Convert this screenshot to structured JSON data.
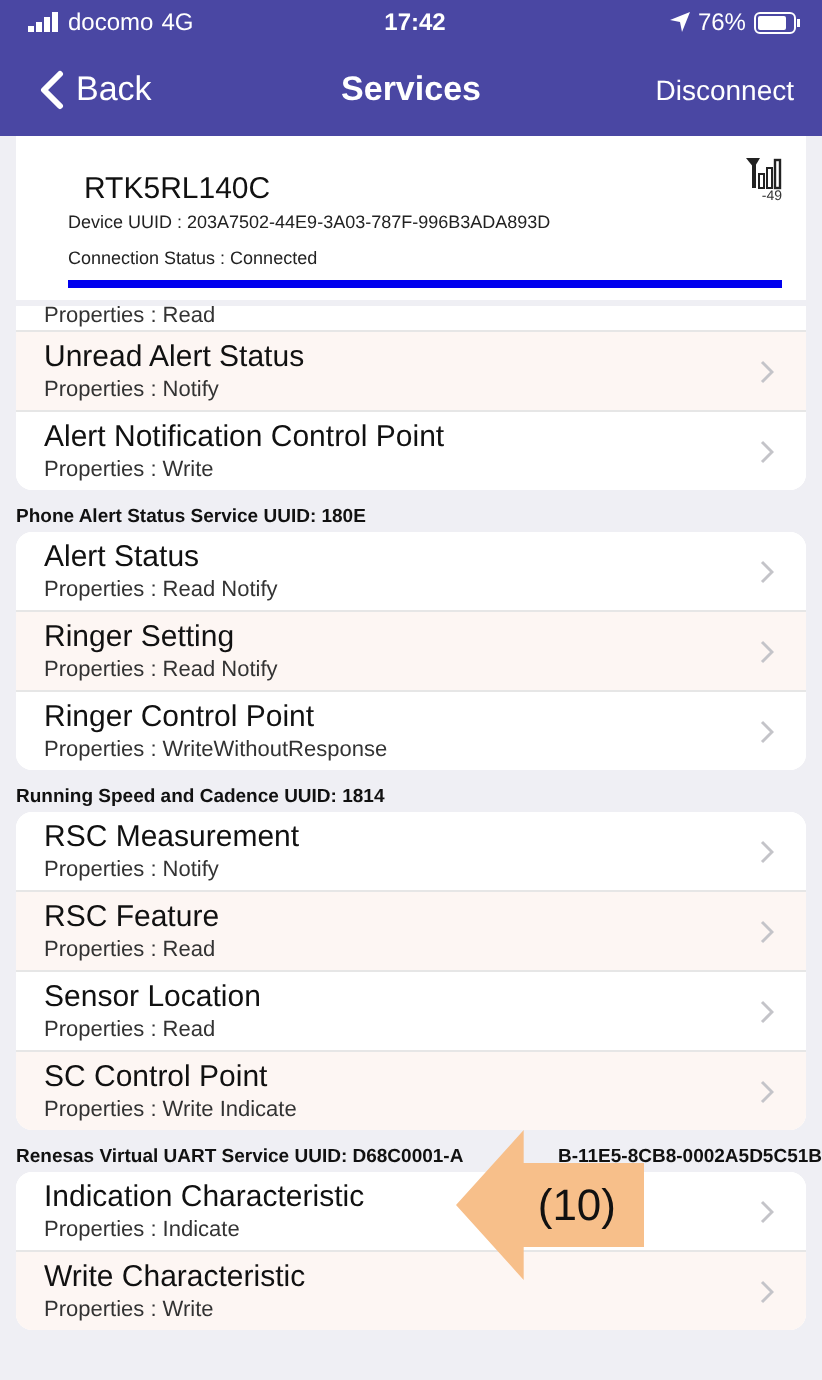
{
  "status_bar": {
    "carrier": "docomo",
    "network": "4G",
    "time": "17:42",
    "battery": "76%"
  },
  "nav": {
    "back": "Back",
    "title": "Services",
    "action": "Disconnect"
  },
  "device": {
    "name": "RTK5RL140C",
    "rssi": "-49",
    "uuid": "Device UUID : 203A7502-44E9-3A03-787F-996B3ADA893D",
    "status": "Connection Status :   Connected"
  },
  "sections": [
    {
      "rows": [
        {
          "name": "",
          "properties": "Properties :  Read"
        },
        {
          "name": "Unread Alert Status",
          "properties": "Properties :  Notify"
        },
        {
          "name": "Alert Notification Control Point",
          "properties": "Properties :  Write"
        }
      ]
    },
    {
      "header_parts": [
        "Phone Alert Status Service   UUID: 180E"
      ],
      "rows": [
        {
          "name": "Alert Status",
          "properties": "Properties :  Read  Notify"
        },
        {
          "name": "Ringer Setting",
          "properties": "Properties :  Read  Notify"
        },
        {
          "name": "Ringer Control Point",
          "properties": "Properties :  WriteWithoutResponse"
        }
      ]
    },
    {
      "header_parts": [
        "Running Speed and Cadence   UUID: 1814"
      ],
      "rows": [
        {
          "name": "RSC Measurement",
          "properties": "Properties :  Notify"
        },
        {
          "name": "RSC Feature",
          "properties": "Properties :  Read"
        },
        {
          "name": "Sensor Location",
          "properties": "Properties :  Read"
        },
        {
          "name": "SC Control Point",
          "properties": "Properties :  Write  Indicate"
        }
      ]
    },
    {
      "header_parts": [
        "Renesas Virtual UART Service   UUID: D68C0001-A",
        "B-11E5-8CB8-0002A5D5C51B"
      ],
      "rows": [
        {
          "name": "Indication Characteristic",
          "properties": "Properties :  Indicate"
        },
        {
          "name": "Write Characteristic",
          "properties": "Properties :  Write"
        }
      ]
    }
  ],
  "callout": {
    "label": "(10)"
  }
}
